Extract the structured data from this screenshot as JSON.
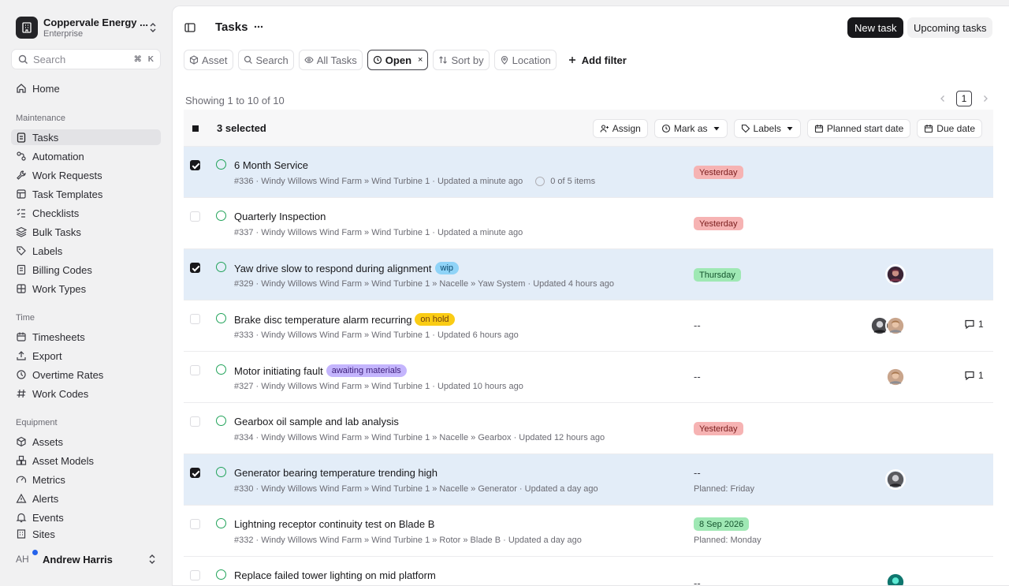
{
  "workspace": {
    "name": "Coppervale Energy ...",
    "plan": "Enterprise"
  },
  "search": {
    "label": "Search",
    "shortcut_cmd": "⌘",
    "shortcut_key": "K"
  },
  "nav": {
    "home": "Home",
    "maintenance_title": "Maintenance",
    "maintenance": [
      "Tasks",
      "Automation",
      "Work Requests",
      "Task Templates",
      "Checklists",
      "Bulk Tasks",
      "Labels",
      "Billing Codes",
      "Work Types"
    ],
    "time_title": "Time",
    "time": [
      "Timesheets",
      "Export",
      "Overtime Rates",
      "Work Codes"
    ],
    "equipment_title": "Equipment",
    "equipment": [
      "Assets",
      "Asset Models",
      "Metrics",
      "Alerts",
      "Events",
      "Sites"
    ]
  },
  "user": {
    "initials": "AH",
    "name": "Andrew Harris"
  },
  "header": {
    "title": "Tasks",
    "new_task": "New task",
    "upcoming": "Upcoming tasks"
  },
  "filters": {
    "asset": "Asset",
    "search": "Search",
    "all_tasks": "All Tasks",
    "open": "Open",
    "open_clear": "×",
    "sort_by": "Sort by",
    "location": "Location",
    "add_filter": "Add filter"
  },
  "list": {
    "showing": "Showing 1 to 10 of 10",
    "page": "1"
  },
  "bulk": {
    "selected": "3 selected",
    "assign": "Assign",
    "mark_as": "Mark as",
    "labels": "Labels",
    "planned_start": "Planned start date",
    "due_date": "Due date"
  },
  "colors": {
    "accent": "#18181b",
    "selected_row": "#e3edf8",
    "status_open": "#22a35a",
    "due_overdue": "#f6b3b3",
    "due_upcoming": "#9fe8b4",
    "tag_wip": "#8fd3f7",
    "tag_hold": "#facc15",
    "tag_awaiting": "#c4b5fd"
  },
  "tasks": [
    {
      "title": "6 Month Service",
      "meta": "#336 · Windy Willows Wind Farm » Wind Turbine 1 · Updated a minute ago",
      "items": "0 of 5 items",
      "due": "Yesterday",
      "selected": true
    },
    {
      "title": "Quarterly Inspection",
      "meta": "#337 · Windy Willows Wind Farm » Wind Turbine 1 · Updated a minute ago",
      "due": "Yesterday",
      "selected": false
    },
    {
      "title": "Yaw drive slow to respond during alignment",
      "tag": "wip",
      "meta": "#329 · Windy Willows Wind Farm » Wind Turbine 1 » Nacelle » Yaw System · Updated 4 hours ago",
      "due": "Thursday",
      "selected": true
    },
    {
      "title": "Brake disc temperature alarm recurring",
      "tag": "on hold",
      "meta": "#333 · Windy Willows Wind Farm » Wind Turbine 1 · Updated 6 hours ago",
      "due": "--",
      "comments": "1",
      "selected": false
    },
    {
      "title": "Motor initiating fault",
      "tag": "awaiting materials",
      "meta": "#327 · Windy Willows Wind Farm » Wind Turbine 1 · Updated 10 hours ago",
      "due": "--",
      "comments": "1",
      "selected": false
    },
    {
      "title": "Gearbox oil sample and lab analysis",
      "meta": "#334 · Windy Willows Wind Farm » Wind Turbine 1 » Nacelle » Gearbox · Updated 12 hours ago",
      "due": "Yesterday",
      "selected": false
    },
    {
      "title": "Generator bearing temperature trending high",
      "meta": "#330 · Windy Willows Wind Farm » Wind Turbine 1 » Nacelle » Generator · Updated a day ago",
      "due": "--",
      "planned": "Planned: Friday",
      "selected": true
    },
    {
      "title": "Lightning receptor continuity test on Blade B",
      "meta": "#332 · Windy Willows Wind Farm » Wind Turbine 1 » Rotor » Blade B · Updated a day ago",
      "due": "8 Sep 2026",
      "planned": "Planned: Monday",
      "selected": false
    },
    {
      "title": "Replace failed tower lighting on mid platform",
      "due": "--",
      "selected": false
    }
  ]
}
